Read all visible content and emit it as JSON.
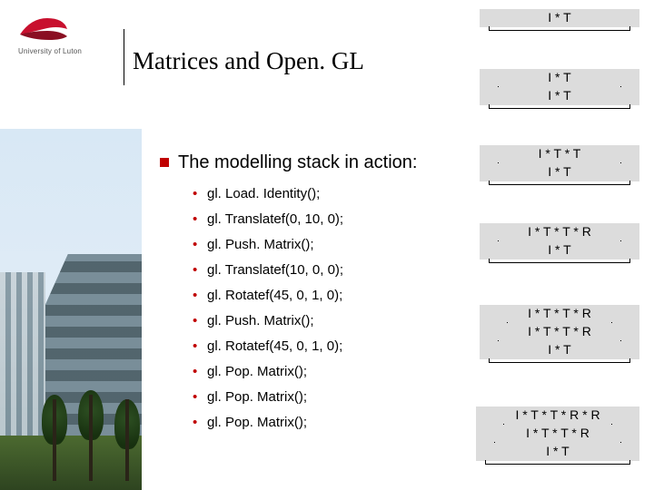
{
  "logo_text": "University of Luton",
  "title": "Matrices and Open. GL",
  "lead": "The modelling stack in action:",
  "code_items": [
    "gl. Load. Identity();",
    "gl. Translatef(0, 10, 0);",
    "gl. Push. Matrix();",
    "gl. Translatef(10, 0, 0);",
    "gl. Rotatef(45, 0, 1, 0);",
    "gl. Push. Matrix();",
    "gl. Rotatef(45, 0, 1, 0);",
    "gl. Pop. Matrix();",
    "gl. Pop. Matrix();",
    "gl. Pop. Matrix();"
  ],
  "stacks": [
    {
      "rows": [
        "I * T"
      ]
    },
    {
      "rows": [
        "I * T",
        "I * T"
      ]
    },
    {
      "rows": [
        "I * T * T",
        "I * T"
      ]
    },
    {
      "rows": [
        "I * T * T * R",
        "I * T"
      ]
    },
    {
      "rows": [
        "I * T * T * R",
        "I * T * T * R",
        "I * T"
      ]
    },
    {
      "rows": [
        "I * T * T * R * R",
        "I * T * T * R",
        "I * T"
      ]
    }
  ]
}
